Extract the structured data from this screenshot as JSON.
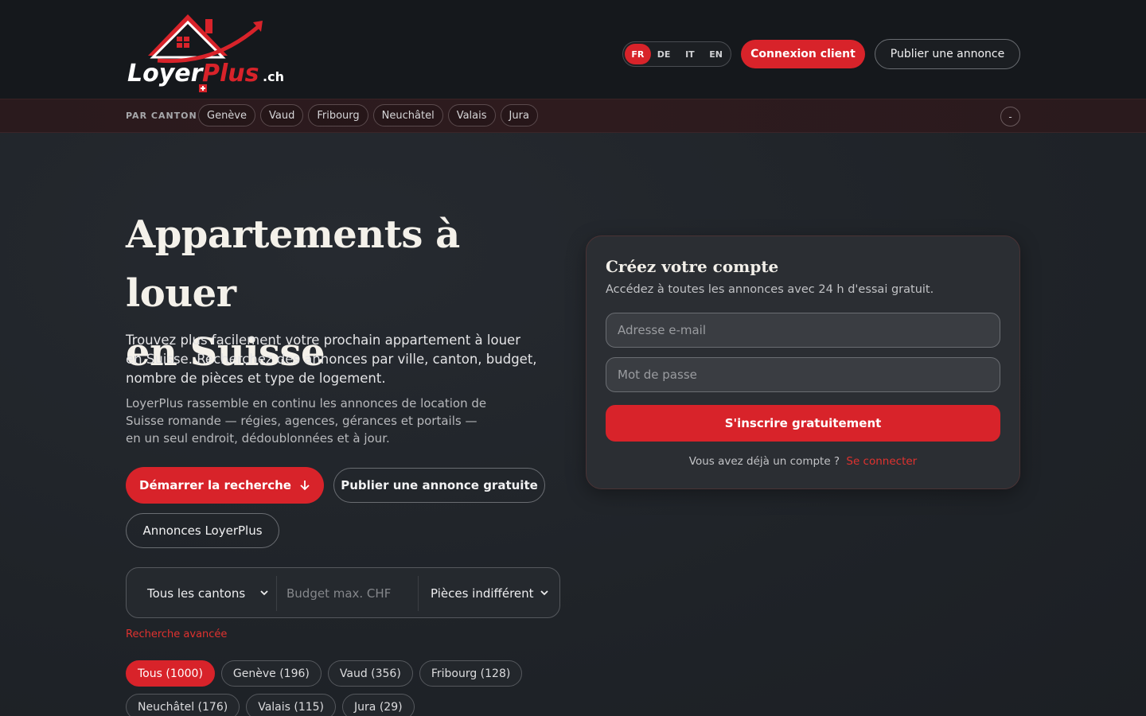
{
  "header": {
    "logo_text": "LoyerPlus.ch",
    "languages": [
      {
        "code": "FR",
        "active": true
      },
      {
        "code": "DE",
        "active": false
      },
      {
        "code": "IT",
        "active": false
      },
      {
        "code": "EN",
        "active": false
      }
    ],
    "login_label": "Connexion client",
    "publish_label": "Publier une annonce"
  },
  "canton_bar": {
    "label": "PAR CANTON",
    "cantons": [
      "Genève",
      "Vaud",
      "Fribourg",
      "Neuchâtel",
      "Valais",
      "Jura"
    ],
    "collapse_symbol": "-"
  },
  "hero": {
    "title_line1": "Appartements à louer",
    "title_line2": "en Suisse",
    "lead": "Trouvez plus facilement votre prochain appartement à louer en Suisse. Recherchez des annonces par ville, canton, budget, nombre de pièces et type de logement.",
    "sub": "LoyerPlus rassemble en continu les annonces de location de Suisse romande — régies, agences, gérances et portails — en un seul endroit, dédoublonnées et à jour.",
    "start_label": "Démarrer la recherche",
    "publish_free_label": "Publier une annonce gratuite",
    "annonces_label": "Annonces LoyerPlus"
  },
  "search": {
    "canton_value": "Tous les cantons",
    "budget_placeholder": "Budget max. CHF",
    "pieces_value": "Pièces indifférent",
    "advanced_label": "Recherche avancée"
  },
  "counts": [
    {
      "label": "Tous (1000)",
      "active": true
    },
    {
      "label": "Genève (196)",
      "active": false
    },
    {
      "label": "Vaud (356)",
      "active": false
    },
    {
      "label": "Fribourg (128)",
      "active": false
    },
    {
      "label": "Neuchâtel (176)",
      "active": false
    },
    {
      "label": "Valais (115)",
      "active": false
    },
    {
      "label": "Jura (29)",
      "active": false
    }
  ],
  "signup": {
    "title": "Créez votre compte",
    "subtitle": "Accédez à toutes les annonces avec 24 h d'essai gratuit.",
    "email_placeholder": "Adresse e-mail",
    "password_placeholder": "Mot de passe",
    "submit_label": "S'inscrire gratuitement",
    "footer_text": "Vous avez déjà un compte ?",
    "login_link": "Se connecter"
  },
  "colors": {
    "accent": "#d8232a",
    "header_bg": "#15181c",
    "page_bg": "#1f2328"
  }
}
